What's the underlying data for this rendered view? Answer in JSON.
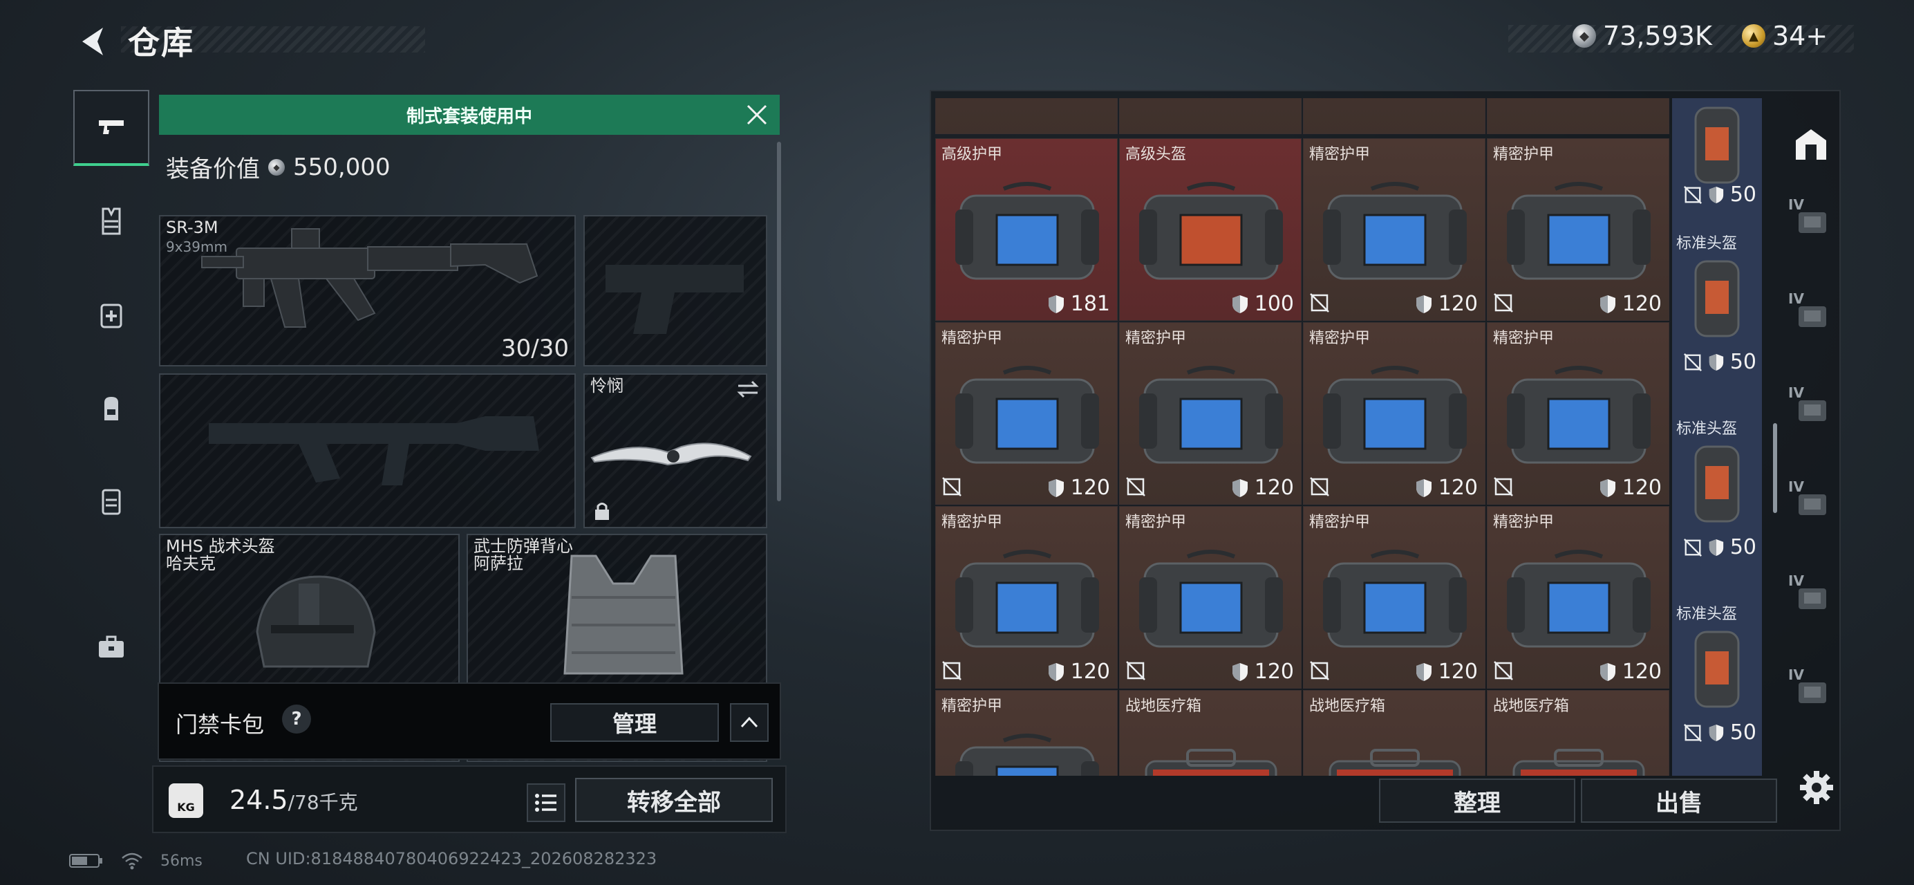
{
  "header": {
    "title": "仓库",
    "currency_silver": "73,593K",
    "currency_gold": "34+",
    "colors": {
      "accent_green": "#1d7a56",
      "rarity_red": "#6b2f30",
      "rarity_brown": "#4c3832",
      "side_blue": "#2e3a55"
    }
  },
  "nav": {
    "items": [
      {
        "icon": "pistol-icon",
        "active": true
      },
      {
        "icon": "vest-icon",
        "active": false
      },
      {
        "icon": "medkit-bag-icon",
        "active": false
      },
      {
        "icon": "backpack-icon",
        "active": false
      },
      {
        "icon": "case-icon",
        "active": false
      },
      {
        "icon": "toolbox-icon",
        "active": false
      }
    ]
  },
  "loadout": {
    "banner": "制式套装使用中",
    "equip_value_label": "装备价值",
    "equip_value": "550,000",
    "primary": {
      "name": "SR-3M",
      "caliber": "9x39mm",
      "ammo": "30/30"
    },
    "melee": {
      "name": "怜悯"
    },
    "helmet": {
      "line1": "MHS 战术头盔",
      "line2": "哈夫克"
    },
    "armor": {
      "line1": "武士防弹背心",
      "line2": "阿萨拉"
    },
    "keycard_label": "门禁卡包",
    "keycard_help": "?",
    "manage_label": "管理",
    "weight_value": "24.5",
    "weight_cap": "/78千克",
    "weight_icon_text": "KG",
    "transfer_label": "转移全部"
  },
  "stash": {
    "cells": [
      {
        "name": "高级护甲",
        "dur": "181",
        "rarity": "red",
        "broken": false,
        "kind": "bag-blue"
      },
      {
        "name": "高级头盔",
        "dur": "100",
        "rarity": "red",
        "broken": false,
        "kind": "bag-red"
      },
      {
        "name": "精密护甲",
        "dur": "120",
        "rarity": "brown",
        "broken": true,
        "kind": "bag"
      },
      {
        "name": "精密护甲",
        "dur": "120",
        "rarity": "brown",
        "broken": true,
        "kind": "bag"
      },
      {
        "name": "精密护甲",
        "dur": "120",
        "rarity": "brown",
        "broken": true,
        "kind": "bag"
      },
      {
        "name": "精密护甲",
        "dur": "120",
        "rarity": "brown",
        "broken": true,
        "kind": "bag"
      },
      {
        "name": "精密护甲",
        "dur": "120",
        "rarity": "brown",
        "broken": true,
        "kind": "bag"
      },
      {
        "name": "精密护甲",
        "dur": "120",
        "rarity": "brown",
        "broken": true,
        "kind": "bag"
      },
      {
        "name": "精密护甲",
        "dur": "120",
        "rarity": "brown",
        "broken": true,
        "kind": "bag"
      },
      {
        "name": "精密护甲",
        "dur": "120",
        "rarity": "brown",
        "broken": true,
        "kind": "bag"
      },
      {
        "name": "精密护甲",
        "dur": "120",
        "rarity": "brown",
        "broken": true,
        "kind": "bag"
      },
      {
        "name": "精密护甲",
        "dur": "120",
        "rarity": "brown",
        "broken": true,
        "kind": "bag"
      },
      {
        "name": "精密护甲",
        "dur": "",
        "rarity": "brown",
        "broken": false,
        "kind": "bag"
      },
      {
        "name": "战地医疗箱",
        "dur": "",
        "rarity": "brown",
        "broken": false,
        "kind": "medbox"
      },
      {
        "name": "战地医疗箱",
        "dur": "",
        "rarity": "brown",
        "broken": false,
        "kind": "medbox"
      },
      {
        "name": "战地医疗箱",
        "dur": "",
        "rarity": "brown",
        "broken": false,
        "kind": "medbox"
      }
    ],
    "side_items": [
      {
        "name": "",
        "dur": "50"
      },
      {
        "name": "标准头盔",
        "dur": "50"
      },
      {
        "name": "标准头盔",
        "dur": "50"
      },
      {
        "name": "标准头盔",
        "dur": "50"
      }
    ],
    "rail": [
      {
        "icon": "stash-home-icon",
        "active": true
      },
      {
        "icon": "stash-tab-iv-1-icon",
        "label": "IV"
      },
      {
        "icon": "stash-tab-iv-2-icon",
        "label": "IV"
      },
      {
        "icon": "stash-tab-iv-3-icon",
        "label": "IV"
      },
      {
        "icon": "stash-tab-iv-4-icon",
        "label": "IV"
      },
      {
        "icon": "stash-tab-iv-5-icon",
        "label": "IV"
      },
      {
        "icon": "stash-tab-iv-6-icon",
        "label": "IV"
      }
    ],
    "sort_label": "整理",
    "sell_label": "出售"
  },
  "status": {
    "ping": "56ms",
    "uid": "CN UID:8184884078040692242​3_202608282323"
  }
}
